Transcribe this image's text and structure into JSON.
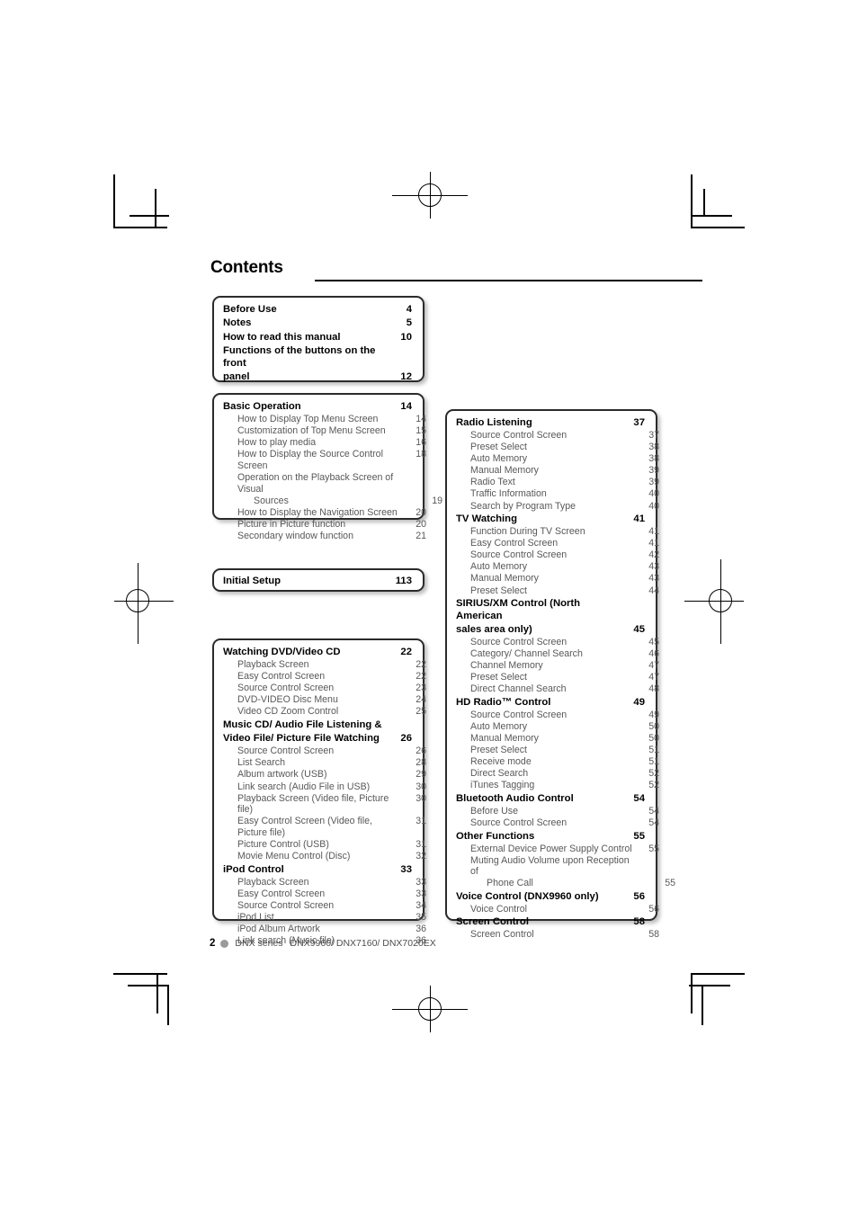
{
  "page": {
    "title": "Contents",
    "footer": {
      "page_number": "2",
      "series": "DNX series",
      "models": "DNX9960/ DNX7160/ DNX7020EX"
    }
  },
  "boxes": [
    {
      "id": "box-before-use",
      "entries": [
        {
          "level": 1,
          "label": "Before Use",
          "page": "4"
        },
        {
          "level": 1,
          "label": "Notes",
          "page": "5"
        },
        {
          "level": 1,
          "label": "How to read this manual",
          "page": "10"
        },
        {
          "level": 1,
          "label": "Functions of the buttons on the front",
          "page": ""
        },
        {
          "level": 1,
          "label": "panel",
          "page": "12"
        }
      ]
    },
    {
      "id": "box-basic-operation",
      "entries": [
        {
          "level": 1,
          "label": "Basic Operation",
          "page": "14"
        },
        {
          "level": 2,
          "label": "How to Display Top Menu Screen",
          "page": "14"
        },
        {
          "level": 2,
          "label": "Customization of Top Menu Screen",
          "page": "15"
        },
        {
          "level": 2,
          "label": "How to play media",
          "page": "16"
        },
        {
          "level": 2,
          "label": "How to Display the Source Control Screen",
          "page": "18"
        },
        {
          "level": 2,
          "label": "Operation on the Playback Screen of Visual",
          "page": ""
        },
        {
          "level": 2,
          "label": "Sources",
          "page": "19",
          "continuation": true
        },
        {
          "level": 2,
          "label": "How to Display the Navigation Screen",
          "page": "20"
        },
        {
          "level": 2,
          "label": "Picture in Picture function",
          "page": "20"
        },
        {
          "level": 2,
          "label": "Secondary window function",
          "page": "21"
        }
      ]
    },
    {
      "id": "box-initial-setup",
      "entries": [
        {
          "level": 1,
          "label": "Initial Setup",
          "page": "113"
        }
      ]
    },
    {
      "id": "box-watching-dvd",
      "entries": [
        {
          "level": 1,
          "label": "Watching DVD/Video CD",
          "page": "22"
        },
        {
          "level": 2,
          "label": "Playback Screen",
          "page": "22"
        },
        {
          "level": 2,
          "label": "Easy Control Screen",
          "page": "22"
        },
        {
          "level": 2,
          "label": "Source Control Screen",
          "page": "23"
        },
        {
          "level": 2,
          "label": "DVD-VIDEO Disc Menu",
          "page": "24"
        },
        {
          "level": 2,
          "label": "Video CD Zoom Control",
          "page": "25"
        },
        {
          "level": 1,
          "label": "Music CD/ Audio File Listening &",
          "page": ""
        },
        {
          "level": 1,
          "label": "Video File/ Picture File Watching",
          "page": "26"
        },
        {
          "level": 2,
          "label": "Source Control Screen",
          "page": "26"
        },
        {
          "level": 2,
          "label": "List Search",
          "page": "28"
        },
        {
          "level": 2,
          "label": "Album artwork (USB)",
          "page": "29"
        },
        {
          "level": 2,
          "label": "Link search (Audio File in USB)",
          "page": "30"
        },
        {
          "level": 2,
          "label": "Playback Screen (Video file, Picture file)",
          "page": "30"
        },
        {
          "level": 2,
          "label": "Easy Control Screen (Video file, Picture file)",
          "page": "31"
        },
        {
          "level": 2,
          "label": "Picture Control (USB)",
          "page": "31"
        },
        {
          "level": 2,
          "label": "Movie Menu Control (Disc)",
          "page": "32"
        },
        {
          "level": 1,
          "label": "iPod Control",
          "page": "33"
        },
        {
          "level": 2,
          "label": "Playback Screen",
          "page": "33"
        },
        {
          "level": 2,
          "label": "Easy Control Screen",
          "page": "33"
        },
        {
          "level": 2,
          "label": "Source Control Screen",
          "page": "34"
        },
        {
          "level": 2,
          "label": "iPod List",
          "page": "35"
        },
        {
          "level": 2,
          "label": "iPod Album Artwork",
          "page": "36"
        },
        {
          "level": 2,
          "label": "Link search (Music file)",
          "page": "36"
        }
      ]
    },
    {
      "id": "box-radio-listening",
      "entries": [
        {
          "level": 1,
          "label": "Radio Listening",
          "page": "37"
        },
        {
          "level": 2,
          "label": "Source Control Screen",
          "page": "37"
        },
        {
          "level": 2,
          "label": "Preset Select",
          "page": "38"
        },
        {
          "level": 2,
          "label": "Auto Memory",
          "page": "38"
        },
        {
          "level": 2,
          "label": "Manual Memory",
          "page": "39"
        },
        {
          "level": 2,
          "label": "Radio Text",
          "page": "39"
        },
        {
          "level": 2,
          "label": "Traffic Information",
          "page": "40"
        },
        {
          "level": 2,
          "label": "Search by Program Type",
          "page": "40"
        },
        {
          "level": 1,
          "label": "TV Watching",
          "page": "41"
        },
        {
          "level": 2,
          "label": "Function During TV Screen",
          "page": "41"
        },
        {
          "level": 2,
          "label": "Easy Control Screen",
          "page": "41"
        },
        {
          "level": 2,
          "label": "Source Control Screen",
          "page": "42"
        },
        {
          "level": 2,
          "label": "Auto Memory",
          "page": "43"
        },
        {
          "level": 2,
          "label": "Manual Memory",
          "page": "43"
        },
        {
          "level": 2,
          "label": "Preset Select",
          "page": "44"
        },
        {
          "level": 1,
          "label": "SIRIUS/XM Control (North American",
          "page": ""
        },
        {
          "level": 1,
          "label": "sales area only)",
          "page": "45"
        },
        {
          "level": 2,
          "label": "Source Control Screen",
          "page": "45"
        },
        {
          "level": 2,
          "label": "Category/ Channel Search",
          "page": "46"
        },
        {
          "level": 2,
          "label": "Channel Memory",
          "page": "47"
        },
        {
          "level": 2,
          "label": "Preset Select",
          "page": "47"
        },
        {
          "level": 2,
          "label": "Direct Channel Search",
          "page": "48"
        },
        {
          "level": 1,
          "label": "HD Radio™ Control",
          "page": "49"
        },
        {
          "level": 2,
          "label": "Source Control Screen",
          "page": "49"
        },
        {
          "level": 2,
          "label": "Auto Memory",
          "page": "50"
        },
        {
          "level": 2,
          "label": "Manual Memory",
          "page": "50"
        },
        {
          "level": 2,
          "label": "Preset Select",
          "page": "51"
        },
        {
          "level": 2,
          "label": "Receive mode",
          "page": "51"
        },
        {
          "level": 2,
          "label": "Direct Search",
          "page": "52"
        },
        {
          "level": 2,
          "label": "iTunes Tagging",
          "page": "52"
        },
        {
          "level": 1,
          "label": "Bluetooth Audio Control",
          "page": "54"
        },
        {
          "level": 2,
          "label": "Before Use",
          "page": "54"
        },
        {
          "level": 2,
          "label": "Source Control Screen",
          "page": "54"
        },
        {
          "level": 1,
          "label": "Other Functions",
          "page": "55"
        },
        {
          "level": 2,
          "label": "External Device Power Supply Control",
          "page": "55"
        },
        {
          "level": 2,
          "label": "Muting Audio Volume upon Reception of",
          "page": ""
        },
        {
          "level": 2,
          "label": "Phone Call",
          "page": "55",
          "continuation": true
        },
        {
          "level": 1,
          "label": "Voice Control (DNX9960 only)",
          "page": "56"
        },
        {
          "level": 2,
          "label": "Voice Control",
          "page": "56"
        },
        {
          "level": 1,
          "label": "Screen Control",
          "page": "58"
        },
        {
          "level": 2,
          "label": "Screen Control",
          "page": "58"
        }
      ]
    }
  ]
}
